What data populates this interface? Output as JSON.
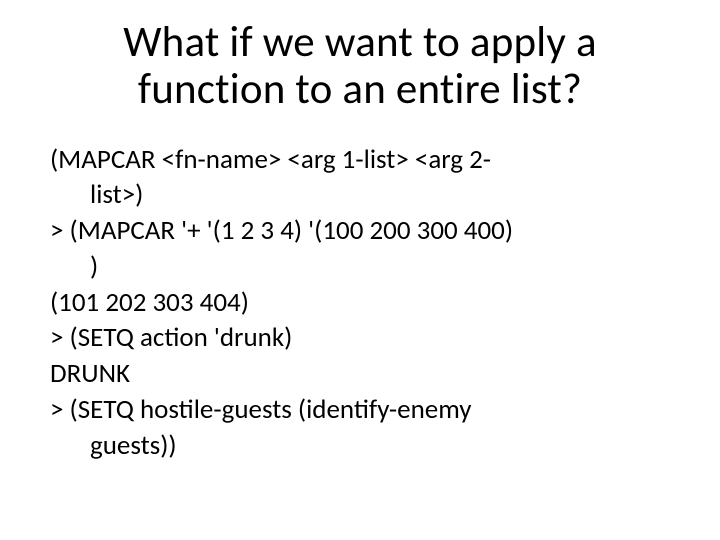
{
  "title": "What if we want to apply a function to an entire list?",
  "lines": {
    "l1a": "(MAPCAR <fn-name> <arg 1-list> <arg 2-",
    "l1b": "list>)",
    "l2a": "> (MAPCAR '+ '(1 2 3 4) '(100 200 300 400)",
    "l2b": ")",
    "l3": "(101 202 303 404)",
    "l4": "> (SETQ action 'drunk)",
    "l5": "DRUNK",
    "l6a": "> (SETQ hostile-guests (identify-enemy",
    "l6b": "guests))"
  }
}
